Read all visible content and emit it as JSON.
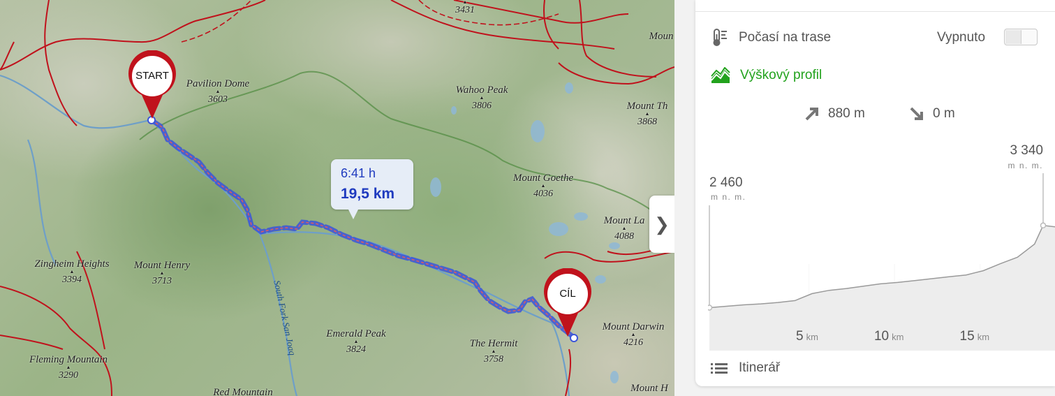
{
  "map": {
    "peaks": [
      {
        "name": "Pavilion Dome",
        "elev": "3603"
      },
      {
        "name": "Wahoo Peak",
        "elev": "3806"
      },
      {
        "name": "Mount Th",
        "elev": "3868"
      },
      {
        "name": "Mount Goethe",
        "elev": "4036"
      },
      {
        "name": "Mount La",
        "elev": "4088"
      },
      {
        "name": "Zingheim Heights",
        "elev": "3394"
      },
      {
        "name": "Mount Henry",
        "elev": "3713"
      },
      {
        "name": "Emerald Peak",
        "elev": "3824"
      },
      {
        "name": "The Hermit",
        "elev": "3758"
      },
      {
        "name": "Mount Darwin",
        "elev": "4216"
      },
      {
        "name": "Fleming Mountain",
        "elev": "3290"
      },
      {
        "name": "Red Mountain",
        "elev": ""
      },
      {
        "name": "Moun",
        "elev": ""
      },
      {
        "name": "Mount H",
        "elev": ""
      },
      {
        "name": "",
        "elev": "3431"
      }
    ],
    "river_label": "South Fork San Joaq",
    "start_marker": "START",
    "end_marker": "CÍL",
    "route_info": {
      "time": "6:41 h",
      "distance": "19,5 km"
    },
    "collapse_icon": "❯",
    "colors": {
      "route": "#3b55d9",
      "marker": "#c0121c",
      "border": "#c0121c"
    }
  },
  "panel": {
    "weather": {
      "icon": "thermometer-icon",
      "label": "Počasí na trase",
      "toggle_label": "Vypnuto",
      "enabled": false
    },
    "profile": {
      "icon": "elevation-profile-icon",
      "label": "Výškový profil",
      "color": "#22a21d"
    },
    "ascent": "880 m",
    "descent": "0 m",
    "itinerary": {
      "icon": "list-icon",
      "label": "Itinerář"
    }
  },
  "chart_data": {
    "type": "area",
    "x": [
      0,
      1,
      2,
      3,
      4,
      5,
      6,
      7,
      8,
      9,
      10,
      11,
      12,
      13,
      14,
      15,
      16,
      17,
      18,
      19,
      19.5
    ],
    "y": [
      2460,
      2475,
      2490,
      2500,
      2515,
      2535,
      2610,
      2645,
      2665,
      2690,
      2715,
      2730,
      2750,
      2770,
      2790,
      2810,
      2855,
      2930,
      3000,
      3140,
      3340
    ],
    "start_label": {
      "value": "2 460",
      "unit": "m n. m."
    },
    "end_label": {
      "value": "3 340",
      "unit": "m n. m."
    },
    "x_ticks": [
      {
        "value": 5,
        "label": "5",
        "unit": "km"
      },
      {
        "value": 10,
        "label": "10",
        "unit": "km"
      },
      {
        "value": 15,
        "label": "15",
        "unit": "km"
      }
    ],
    "xlim": [
      0,
      19.5
    ],
    "grid": true
  }
}
